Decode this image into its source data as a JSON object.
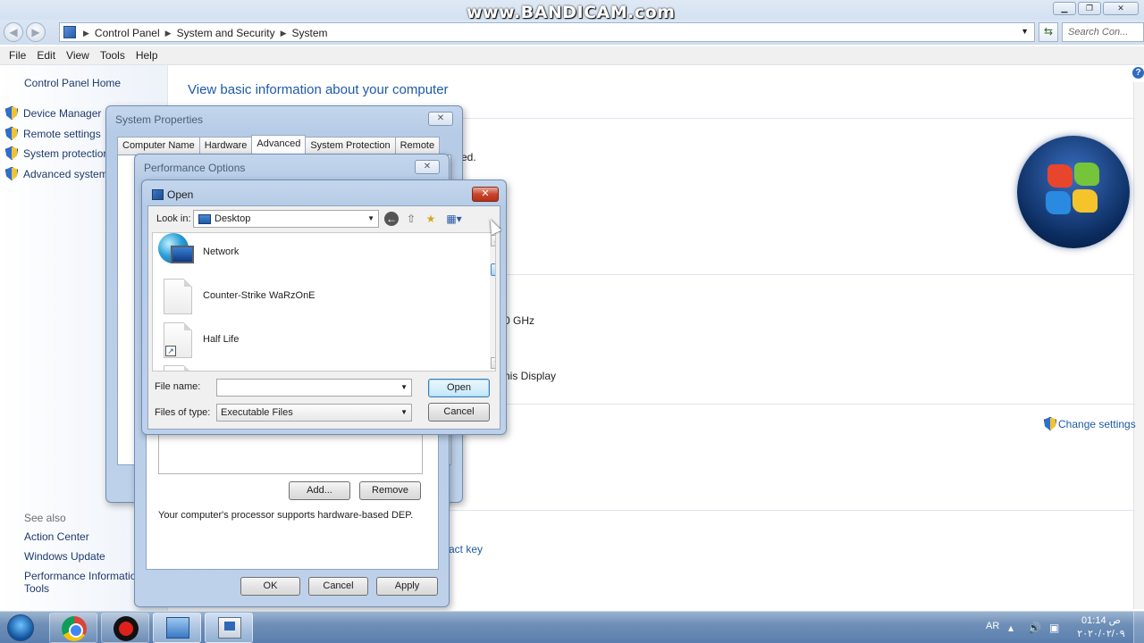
{
  "watermark": "www.BANDICAM.com",
  "address": {
    "crumbs": [
      "Control Panel",
      "System and Security",
      "System"
    ],
    "search_placeholder": "Search Con..."
  },
  "menubar": [
    "File",
    "Edit",
    "View",
    "Tools",
    "Help"
  ],
  "left_pane": {
    "home": "Control Panel Home",
    "items": [
      "Device Manager",
      "Remote settings",
      "System protection",
      "Advanced system"
    ],
    "see_also": "See also",
    "see_also_links": [
      "Action Center",
      "Windows Update",
      "Performance Information and",
      "Tools"
    ]
  },
  "main": {
    "title": "View basic information about your computer",
    "partial_1": "ed.",
    "partial_2": "0 GHz",
    "partial_3": "his Display",
    "change_settings": "Change settings",
    "partial_4": "act key"
  },
  "system_properties": {
    "title": "System Properties",
    "tabs": [
      "Computer Name",
      "Hardware",
      "Advanced",
      "System Protection",
      "Remote"
    ],
    "active_tab": "Advanced"
  },
  "performance_options": {
    "title": "Performance Options",
    "add_button": "Add...",
    "remove_button": "Remove",
    "dep_text": "Your computer's processor supports hardware-based DEP.",
    "ok": "OK",
    "cancel": "Cancel",
    "apply": "Apply"
  },
  "open_dialog": {
    "title": "Open",
    "look_in_label": "Look in:",
    "look_in_value": "Desktop",
    "files": [
      {
        "name": "Network",
        "icon": "network-icon"
      },
      {
        "name": "Counter-Strike WaRzOnE",
        "icon": "file-icon"
      },
      {
        "name": "Half Life",
        "icon": "shortcut-file-icon"
      }
    ],
    "file_name_label": "File name:",
    "file_name_value": "",
    "files_of_type_label": "Files of type:",
    "files_of_type_value": "Executable Files",
    "open_button": "Open",
    "cancel_button": "Cancel"
  },
  "taskbar": {
    "language": "AR",
    "time": "01:14 ص",
    "date": "٢٠٢٠/٠٢/٠٩"
  }
}
